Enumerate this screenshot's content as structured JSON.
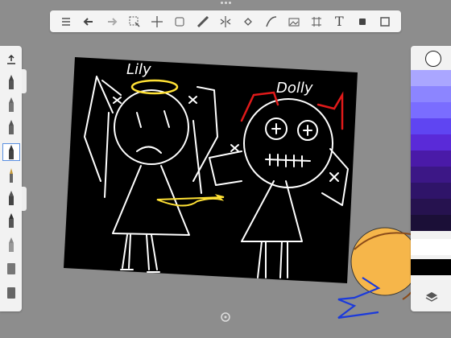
{
  "toolbar": {
    "items": [
      {
        "name": "list-icon"
      },
      {
        "name": "undo-icon"
      },
      {
        "name": "redo-icon"
      },
      {
        "name": "selection-icon"
      },
      {
        "name": "transform-icon"
      },
      {
        "name": "layers-stack-icon"
      },
      {
        "name": "ruler-icon"
      },
      {
        "name": "symmetry-icon"
      },
      {
        "name": "fill-icon"
      },
      {
        "name": "curve-icon"
      },
      {
        "name": "image-icon"
      },
      {
        "name": "perspective-icon"
      },
      {
        "name": "text-icon",
        "label": "T"
      },
      {
        "name": "stamp-icon"
      },
      {
        "name": "fullscreen-icon"
      }
    ]
  },
  "drawing": {
    "left_label": "Lily",
    "right_label": "Dolly"
  },
  "colors": {
    "background": "#8d8d8d",
    "canvas": "#000000",
    "stroke": "#ffffff",
    "halo": "#ffe135",
    "horns": "#e01a1a",
    "selected_brush_border": "#5a8fe0"
  },
  "palette": [
    "#aaa6ff",
    "#8c85ff",
    "#7a6dff",
    "#5f45f2",
    "#5a2ad8",
    "#4a1aa8",
    "#3c1786",
    "#2f1469",
    "#26124f",
    "#1b0f37",
    "#ffffff",
    "#000000"
  ]
}
